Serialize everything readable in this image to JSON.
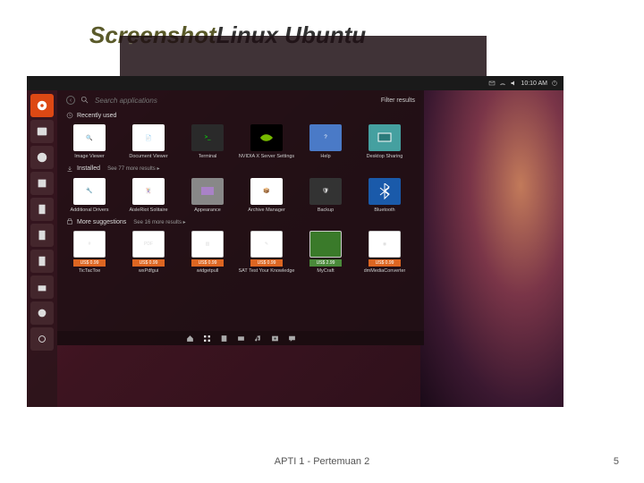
{
  "slide": {
    "title_prefix": "Screenshot",
    "title_dash": " – ",
    "title_rest": "Linux Ubuntu",
    "footer": "APTI 1 - Pertemuan 2",
    "page": "5"
  },
  "topbar": {
    "time": "10:10 AM"
  },
  "dash_panel": {
    "search_placeholder": "Search applications",
    "filter_label": "Filter results",
    "sections": {
      "recent": {
        "label": "Recently used"
      },
      "installed": {
        "label": "Installed",
        "more": "See 77 more results ▸"
      },
      "suggestions": {
        "label": "More suggestions",
        "more": "See 16 more results ▸"
      }
    },
    "recent_apps": [
      {
        "label": "Image Viewer"
      },
      {
        "label": "Document Viewer"
      },
      {
        "label": "Terminal"
      },
      {
        "label": "NVIDIA X Server Settings"
      },
      {
        "label": "Help"
      },
      {
        "label": "Desktop Sharing"
      }
    ],
    "installed_apps": [
      {
        "label": "Additional Drivers"
      },
      {
        "label": "AisleRiot Solitaire"
      },
      {
        "label": "Appearance"
      },
      {
        "label": "Archive Manager"
      },
      {
        "label": "Backup"
      },
      {
        "label": "Bluetooth"
      }
    ],
    "suggestions_apps": [
      {
        "label": "TicTacToe",
        "price": "US$ 0.99"
      },
      {
        "label": "wxPdfgui",
        "price": "US$ 0.99",
        "badge": "PDF"
      },
      {
        "label": "widgetpull",
        "price": "US$ 0.99"
      },
      {
        "label": "SAT Test Your Knowledge",
        "price": "US$ 0.99"
      },
      {
        "label": "MyCraft",
        "price": "US$ 2.99"
      },
      {
        "label": "dmMediaConverter",
        "price": "US$ 0.99"
      }
    ]
  }
}
